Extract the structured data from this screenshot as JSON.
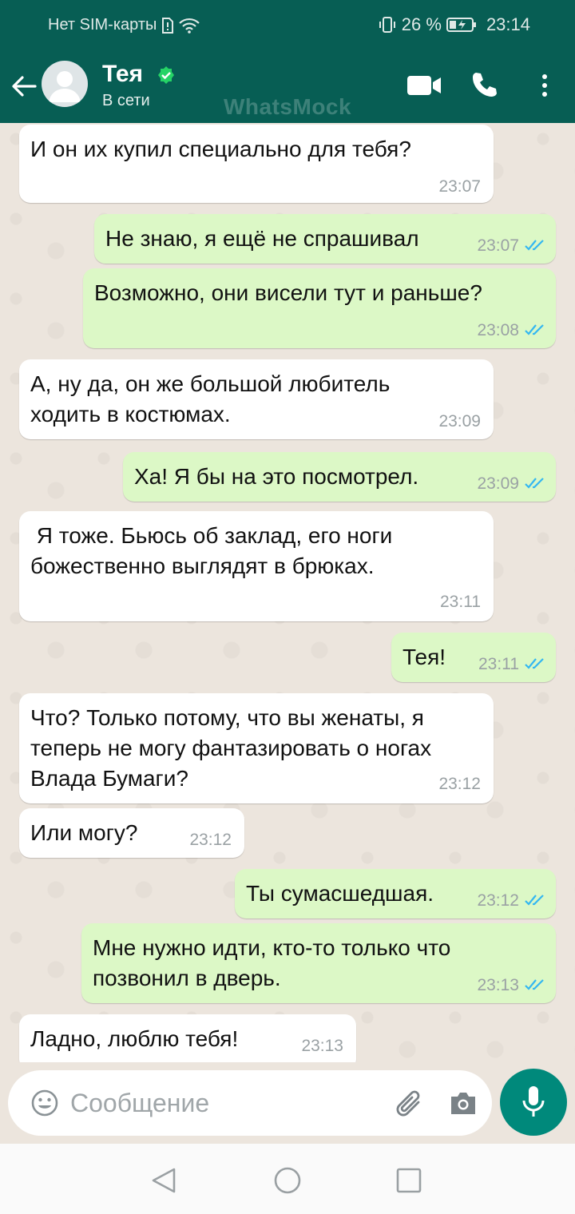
{
  "status_bar": {
    "carrier": "Нет SIM-карты",
    "battery": "26 %",
    "time": "23:14"
  },
  "header": {
    "contact_name": "Тея",
    "contact_status": "В сети",
    "watermark": "WhatsMock"
  },
  "messages": [
    {
      "direction": "in",
      "text": "И он их купил специально для тебя?",
      "time": "23:07"
    },
    {
      "direction": "out",
      "text": "Не знаю, я ещё не спрашивал",
      "time": "23:07",
      "read": true
    },
    {
      "direction": "out",
      "text": "Возможно, они висели тут и раньше?",
      "time": "23:08",
      "read": true
    },
    {
      "direction": "in",
      "text": "А, ну да, он же большой любитель\nходить в костюмах.",
      "time": "23:09"
    },
    {
      "direction": "out",
      "text": "Ха! Я бы на это посмотрел.",
      "time": "23:09",
      "read": true
    },
    {
      "direction": "in",
      "text": " Я тоже. Бьюсь об заклад, его ноги\nбожественно выглядят в брюках.",
      "time": "23:11"
    },
    {
      "direction": "out",
      "text": "Тея!",
      "time": "23:11",
      "read": true
    },
    {
      "direction": "in",
      "text": "Что? Только потому, что вы женаты, я\nтеперь не могу фантазировать о ногах\nВлада Бумаги?",
      "time": "23:12"
    },
    {
      "direction": "in",
      "text": "Или могу?",
      "time": "23:12"
    },
    {
      "direction": "out",
      "text": "Ты сумасшедшая.",
      "time": "23:12",
      "read": true
    },
    {
      "direction": "out",
      "text": "Мне нужно идти, кто-то только что\nпозвонил в дверь.",
      "time": "23:13",
      "read": true
    },
    {
      "direction": "in",
      "text": "Ладно, люблю тебя!",
      "time": "23:13"
    }
  ],
  "input": {
    "placeholder": "Сообщение"
  },
  "colors": {
    "header": "#075e54",
    "outgoing_bubble": "#dcf8c6",
    "incoming_bubble": "#ffffff",
    "mic_button": "#00897b",
    "read_ticks": "#34b7f1"
  }
}
